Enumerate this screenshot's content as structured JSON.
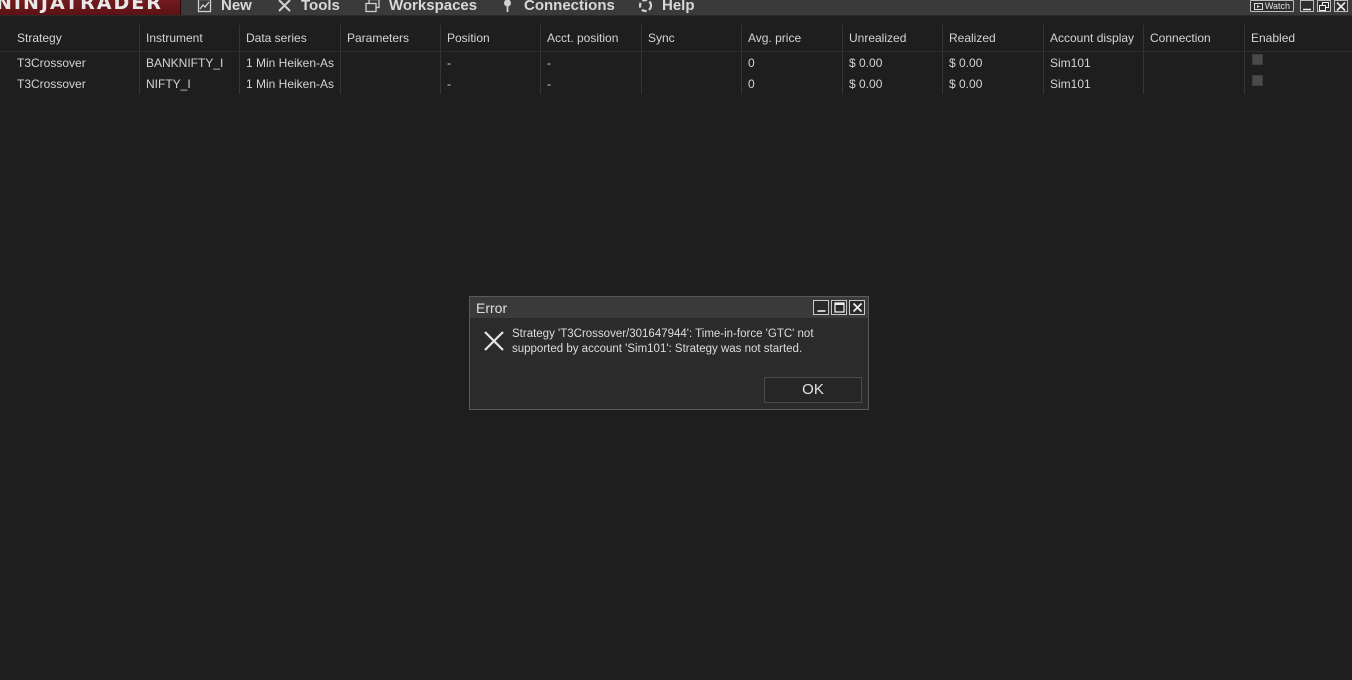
{
  "app": {
    "logo_text": "NINJATRADER"
  },
  "menu": {
    "items": [
      {
        "label": "New",
        "icon": "new-chart-icon"
      },
      {
        "label": "Tools",
        "icon": "tools-icon"
      },
      {
        "label": "Workspaces",
        "icon": "workspaces-icon"
      },
      {
        "label": "Connections",
        "icon": "plug-icon"
      },
      {
        "label": "Help",
        "icon": "help-lifebuoy-icon"
      }
    ],
    "watch_label": "Watch"
  },
  "grid": {
    "columns": [
      "Strategy",
      "Instrument",
      "Data series",
      "Parameters",
      "Position",
      "Acct. position",
      "Sync",
      "Avg. price",
      "Unrealized",
      "Realized",
      "Account display",
      "Connection",
      "Enabled"
    ],
    "rows": [
      [
        "T3Crossover",
        "BANKNIFTY_I",
        "1 Min Heiken-As",
        "",
        "-",
        "-",
        "",
        "0",
        "$ 0.00",
        "$ 0.00",
        "Sim101",
        "",
        ""
      ],
      [
        "T3Crossover",
        "NIFTY_I",
        "1 Min Heiken-As",
        "",
        "-",
        "-",
        "",
        "0",
        "$ 0.00",
        "$ 0.00",
        "Sim101",
        "",
        ""
      ]
    ],
    "enabled": [
      false,
      false
    ]
  },
  "dialog": {
    "title": "Error",
    "icon": "error-x-icon",
    "message": "Strategy 'T3Crossover/301647944': Time-in-force 'GTC' not supported by account 'Sim101': Strategy was not started.",
    "ok_label": "OK"
  },
  "colors": {
    "background": "#1e1e1e",
    "menubar": "#3a3a3a",
    "logo_red": "#7a1f22",
    "text": "#d6d6d6"
  }
}
